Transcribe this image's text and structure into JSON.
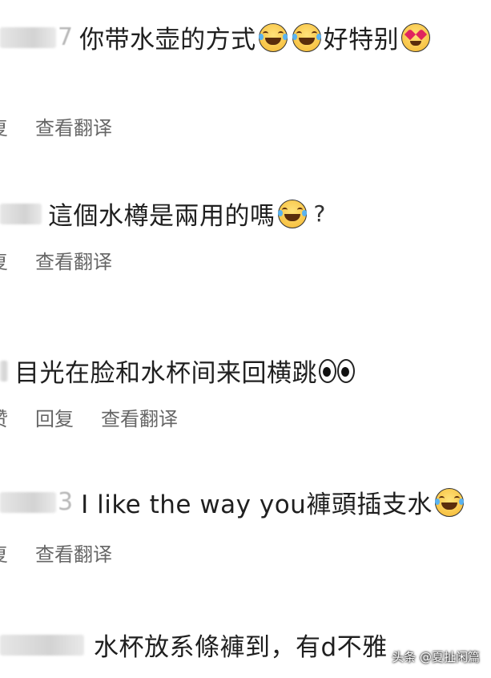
{
  "comments": [
    {
      "faint_prefix": "7",
      "text": "你带水壶的方式",
      "text_after": "好特别",
      "action_cut": "复",
      "translate": "查看翻译"
    },
    {
      "text": "這個水樽是兩用的嗎",
      "question": "?",
      "action_cut": "复",
      "translate": "查看翻译"
    },
    {
      "text": "目光在脸和水杯间来回横跳",
      "like": "赞",
      "reply": "回复",
      "translate": "查看翻译"
    },
    {
      "faint_prefix": "3",
      "text": "I like the way you褲頭插支水",
      "action_cut": "复",
      "translate": "查看翻译"
    },
    {
      "text": "水杯放系條褲到，有d不雅"
    }
  ],
  "watermark": "头条 @夏扯闲篇",
  "icons": {
    "laugh": "face-with-tears-of-joy-icon",
    "heart_eyes": "smiling-face-with-heart-eyes-icon",
    "eyes": "eyes-icon"
  },
  "colors": {
    "text": "#1f1f1f",
    "action": "#666666",
    "background": "#ffffff"
  }
}
